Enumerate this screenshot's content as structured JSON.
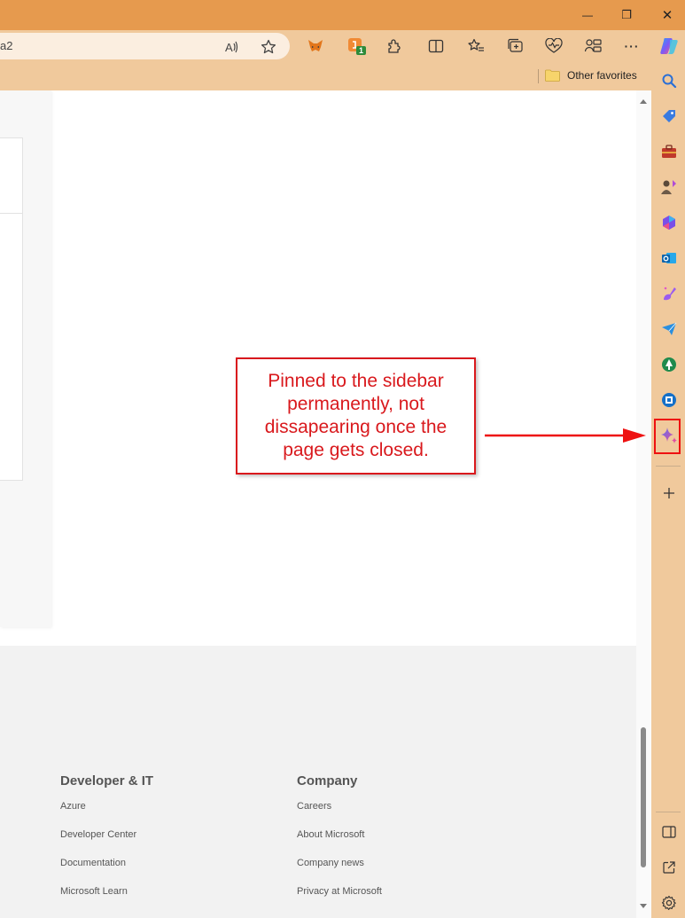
{
  "window": {
    "minimize": "—",
    "restore": "❐",
    "close": "✕"
  },
  "address": {
    "url_fragment": "a2"
  },
  "favorites": {
    "other_label": "Other favorites"
  },
  "toolbar": {
    "extension_badge": "1",
    "more_label": "···"
  },
  "annotation": {
    "text": "Pinned to the sidebar permanently, not dissapearing once the page gets closed.",
    "color": "#d9191d"
  },
  "footer": {
    "columns": [
      {
        "title": "Developer & IT",
        "links": [
          "Azure",
          "Developer Center",
          "Documentation",
          "Microsoft Learn"
        ]
      },
      {
        "title": "Company",
        "links": [
          "Careers",
          "About Microsoft",
          "Company news",
          "Privacy at Microsoft"
        ]
      }
    ]
  },
  "colors": {
    "titlebar": "#e69a4e",
    "toolbar": "#f0c99c",
    "highlight": "#e11111"
  },
  "sidebar": {
    "items": [
      "search-icon",
      "shopping-tag-icon",
      "tools-briefcase-icon",
      "games-icon",
      "microsoft-365-icon",
      "outlook-icon",
      "designer-icon",
      "drop-icon",
      "app-icon",
      "app-icon-2",
      "copilot-icon",
      "add-icon",
      "split-screen-icon",
      "open-external-icon",
      "settings-icon"
    ]
  }
}
